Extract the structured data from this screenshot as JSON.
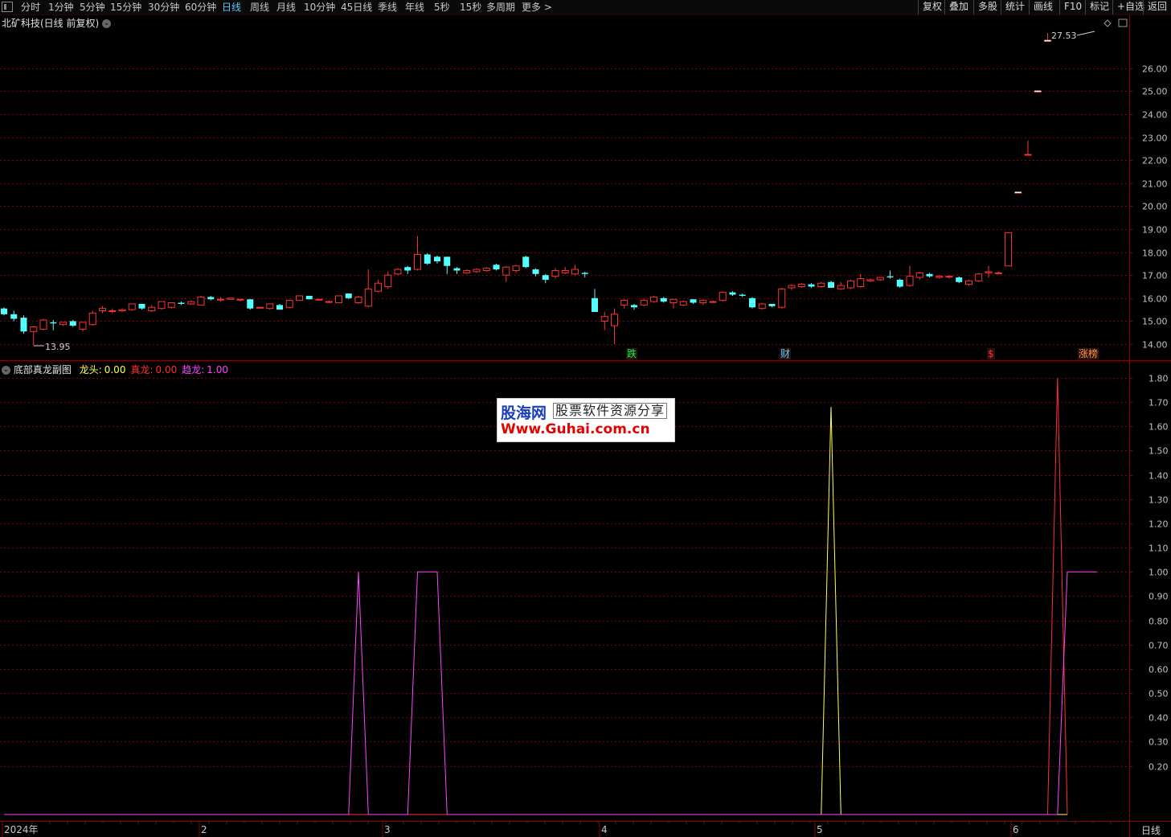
{
  "toolbar": {
    "periods": [
      {
        "label": "分时"
      },
      {
        "label": "1分钟"
      },
      {
        "label": "5分钟"
      },
      {
        "label": "15分钟"
      },
      {
        "label": "30分钟"
      },
      {
        "label": "60分钟"
      },
      {
        "label": "日线",
        "active": true
      },
      {
        "label": "周线"
      },
      {
        "label": "月线"
      },
      {
        "label": "10分钟"
      },
      {
        "label": "45日线"
      },
      {
        "label": "季线"
      },
      {
        "label": "年线"
      },
      {
        "label": "5秒"
      },
      {
        "label": "15秒"
      },
      {
        "label": "多周期"
      },
      {
        "label": "更多 >"
      }
    ],
    "actions": [
      "复权",
      "叠加",
      "多股",
      "统计",
      "画线",
      "F10",
      "标记",
      "+自选",
      "返回"
    ]
  },
  "main_panel": {
    "title": "北矿科技(日线 前复权)",
    "high_label": "27.53",
    "low_label": "13.95",
    "events": [
      {
        "text": "跌",
        "color": "#00ff44"
      },
      {
        "text": "财",
        "color": "#5cc8ff"
      },
      {
        "text": "$",
        "color": "#ff3030"
      },
      {
        "text": "涨榜",
        "color": "#ff9b3c"
      }
    ]
  },
  "sub_panel": {
    "title": "底部真龙副图",
    "items": [
      {
        "name": "龙头",
        "value": "0.00",
        "color": "#ffff55"
      },
      {
        "name": "真龙",
        "value": "0.00",
        "color": "#ff3030"
      },
      {
        "name": "趋龙",
        "value": "1.00",
        "color": "#ff44ff"
      }
    ]
  },
  "x_axis": [
    "2024年",
    "2",
    "3",
    "4",
    "5",
    "6"
  ],
  "bottom_right_label": "日线",
  "watermark": {
    "logo": "股海网",
    "tagline": "股票软件资源分享",
    "url": "Www.Guhai.com.cn"
  },
  "colors": {
    "up": "#ff3232",
    "down": "#54ffff",
    "grid": "#8b0000",
    "axis": "#8b0000"
  },
  "chart_data": [
    {
      "type": "candlestick",
      "title": "北矿科技(日线 前复权)",
      "ylim": [
        13.8,
        27.6
      ],
      "y_ticks": [
        14.0,
        15.0,
        16.0,
        17.0,
        18.0,
        19.0,
        20.0,
        21.0,
        22.0,
        23.0,
        24.0,
        25.0,
        26.0
      ],
      "x_ticks": [
        "2024年",
        "2",
        "3",
        "4",
        "5",
        "6"
      ],
      "candles": [
        [
          15.55,
          15.3,
          15.6,
          15.25
        ],
        [
          15.3,
          15.1,
          15.45,
          15.0
        ],
        [
          15.15,
          14.55,
          15.25,
          14.45
        ],
        [
          14.55,
          14.75,
          14.8,
          13.95
        ],
        [
          14.65,
          15.05,
          15.1,
          14.6
        ],
        [
          14.95,
          14.9,
          15.05,
          14.6
        ],
        [
          14.85,
          14.95,
          14.95,
          14.8
        ],
        [
          15.0,
          14.8,
          15.05,
          14.75
        ],
        [
          14.65,
          14.95,
          14.95,
          14.55
        ],
        [
          14.85,
          15.35,
          15.45,
          14.8
        ],
        [
          15.45,
          15.55,
          15.65,
          15.35
        ],
        [
          15.45,
          15.45,
          15.55,
          15.35
        ],
        [
          15.45,
          15.5,
          15.55,
          15.4
        ],
        [
          15.5,
          15.75,
          15.75,
          15.45
        ],
        [
          15.75,
          15.55,
          15.75,
          15.5
        ],
        [
          15.45,
          15.6,
          15.7,
          15.4
        ],
        [
          15.55,
          15.85,
          15.85,
          15.5
        ],
        [
          15.6,
          15.8,
          15.8,
          15.55
        ],
        [
          15.8,
          15.75,
          15.85,
          15.7
        ],
        [
          15.75,
          15.85,
          15.9,
          15.7
        ],
        [
          15.7,
          16.05,
          16.1,
          15.7
        ],
        [
          16.05,
          15.95,
          16.1,
          15.9
        ],
        [
          15.95,
          15.95,
          16.05,
          15.85
        ],
        [
          15.95,
          16.0,
          16.0,
          15.95
        ],
        [
          15.95,
          15.95,
          15.95,
          15.85
        ],
        [
          15.95,
          15.55,
          15.95,
          15.5
        ],
        [
          15.6,
          15.6,
          15.6,
          15.55
        ],
        [
          15.55,
          15.75,
          15.75,
          15.5
        ],
        [
          15.7,
          15.5,
          15.75,
          15.5
        ],
        [
          15.6,
          15.9,
          15.9,
          15.55
        ],
        [
          15.9,
          16.1,
          16.1,
          15.9
        ],
        [
          16.1,
          15.95,
          16.1,
          15.95
        ],
        [
          15.95,
          15.95,
          15.95,
          15.9
        ],
        [
          15.85,
          15.85,
          15.9,
          15.8
        ],
        [
          15.8,
          16.1,
          16.1,
          15.8
        ],
        [
          16.2,
          16.0,
          16.2,
          15.95
        ],
        [
          15.8,
          16.05,
          16.1,
          15.75
        ],
        [
          15.65,
          16.4,
          17.25,
          15.6
        ],
        [
          16.3,
          16.65,
          16.8,
          16.25
        ],
        [
          16.5,
          17.0,
          17.15,
          16.4
        ],
        [
          17.05,
          17.25,
          17.3,
          17.0
        ],
        [
          17.35,
          17.2,
          17.4,
          17.05
        ],
        [
          17.25,
          17.9,
          18.7,
          17.2
        ],
        [
          17.9,
          17.5,
          17.95,
          17.45
        ],
        [
          17.8,
          17.6,
          17.85,
          17.5
        ],
        [
          17.8,
          17.4,
          17.8,
          17.05
        ],
        [
          17.3,
          17.2,
          17.35,
          17.05
        ],
        [
          17.1,
          17.2,
          17.25,
          17.05
        ],
        [
          17.15,
          17.25,
          17.3,
          17.1
        ],
        [
          17.2,
          17.3,
          17.35,
          17.15
        ],
        [
          17.45,
          17.25,
          17.5,
          17.2
        ],
        [
          17.0,
          17.35,
          17.4,
          16.7
        ],
        [
          17.2,
          17.4,
          17.45,
          17.1
        ],
        [
          17.8,
          17.35,
          17.85,
          17.3
        ],
        [
          17.25,
          17.05,
          17.3,
          16.95
        ],
        [
          17.0,
          16.8,
          17.05,
          16.65
        ],
        [
          16.95,
          17.2,
          17.3,
          16.85
        ],
        [
          17.1,
          17.2,
          17.35,
          17.05
        ],
        [
          17.05,
          17.25,
          17.45,
          17.0
        ],
        [
          17.1,
          17.05,
          17.15,
          16.9
        ],
        [
          16.0,
          15.4,
          16.4,
          15.4
        ],
        [
          15.0,
          15.2,
          15.4,
          14.6
        ],
        [
          14.8,
          15.3,
          15.55,
          14.0
        ],
        [
          15.7,
          15.9,
          15.95,
          15.55
        ],
        [
          15.7,
          15.6,
          15.75,
          15.5
        ],
        [
          15.7,
          15.9,
          15.95,
          15.65
        ],
        [
          15.85,
          16.05,
          16.1,
          15.8
        ],
        [
          16.0,
          15.85,
          16.05,
          15.8
        ],
        [
          15.8,
          15.95,
          15.95,
          15.55
        ],
        [
          15.7,
          15.85,
          15.9,
          15.65
        ],
        [
          15.95,
          15.8,
          15.95,
          15.75
        ],
        [
          15.8,
          15.9,
          15.95,
          15.7
        ],
        [
          15.85,
          15.85,
          15.9,
          15.8
        ],
        [
          15.9,
          16.25,
          16.3,
          15.85
        ],
        [
          16.25,
          16.15,
          16.3,
          16.1
        ],
        [
          16.15,
          16.1,
          16.2,
          16.05
        ],
        [
          16.0,
          15.6,
          16.05,
          15.55
        ],
        [
          15.55,
          15.75,
          15.8,
          15.5
        ],
        [
          15.75,
          15.65,
          15.75,
          15.6
        ],
        [
          15.6,
          16.4,
          16.45,
          15.55
        ],
        [
          16.45,
          16.55,
          16.6,
          16.35
        ],
        [
          16.5,
          16.6,
          16.65,
          16.45
        ],
        [
          16.6,
          16.5,
          16.65,
          16.45
        ],
        [
          16.5,
          16.65,
          16.7,
          16.45
        ],
        [
          16.7,
          16.45,
          16.75,
          16.45
        ],
        [
          16.4,
          16.55,
          16.7,
          16.35
        ],
        [
          16.45,
          16.75,
          16.8,
          16.4
        ],
        [
          16.5,
          16.85,
          17.05,
          16.45
        ],
        [
          16.75,
          16.8,
          16.85,
          16.7
        ],
        [
          16.8,
          16.9,
          16.9,
          16.75
        ],
        [
          16.95,
          16.9,
          17.2,
          16.85
        ],
        [
          16.8,
          16.5,
          16.85,
          16.45
        ],
        [
          16.55,
          16.95,
          17.4,
          16.5
        ],
        [
          16.9,
          17.1,
          17.15,
          16.8
        ],
        [
          17.05,
          16.95,
          17.1,
          16.9
        ],
        [
          16.9,
          16.95,
          17.0,
          16.85
        ],
        [
          16.95,
          16.95,
          17.0,
          16.85
        ],
        [
          16.9,
          16.7,
          16.95,
          16.65
        ],
        [
          16.6,
          16.75,
          16.8,
          16.55
        ],
        [
          16.75,
          17.05,
          17.1,
          16.7
        ],
        [
          17.1,
          17.15,
          17.4,
          16.9
        ],
        [
          17.1,
          17.1,
          17.15,
          17.05
        ],
        [
          17.4,
          18.85,
          18.85,
          17.4
        ],
        [
          20.6,
          20.6,
          20.6,
          20.6
        ],
        [
          22.25,
          22.25,
          22.85,
          22.25
        ],
        [
          25.0,
          25.0,
          25.0,
          25.0
        ],
        [
          27.2,
          27.2,
          27.53,
          27.2
        ]
      ]
    },
    {
      "type": "line",
      "title": "底部真龙副图",
      "ylim": [
        0,
        1.85
      ],
      "y_ticks": [
        0.2,
        0.3,
        0.4,
        0.5,
        0.6,
        0.7,
        0.8,
        0.9,
        1.0,
        1.1,
        1.2,
        1.3,
        1.4,
        1.5,
        1.6,
        1.7,
        1.8
      ],
      "series": [
        {
          "name": "龙头",
          "color": "#ffff55",
          "points": [
            [
              0,
              0
            ],
            [
              83,
              0
            ],
            [
              84,
              1.68
            ],
            [
              85,
              0
            ],
            [
              108,
              0
            ]
          ]
        },
        {
          "name": "真龙",
          "color": "#ff3030",
          "points": [
            [
              0,
              0
            ],
            [
              106,
              0
            ],
            [
              107,
              1.8
            ],
            [
              108,
              0
            ]
          ]
        },
        {
          "name": "趋龙",
          "color": "#ff44ff",
          "points": [
            [
              0,
              0
            ],
            [
              35,
              0
            ],
            [
              36,
              1.0
            ],
            [
              37,
              0
            ],
            [
              41,
              0
            ],
            [
              42,
              1.0
            ],
            [
              44,
              1.0
            ],
            [
              45,
              0
            ],
            [
              107,
              0
            ],
            [
              108,
              1.0
            ],
            [
              111,
              1.0
            ]
          ]
        }
      ]
    }
  ]
}
